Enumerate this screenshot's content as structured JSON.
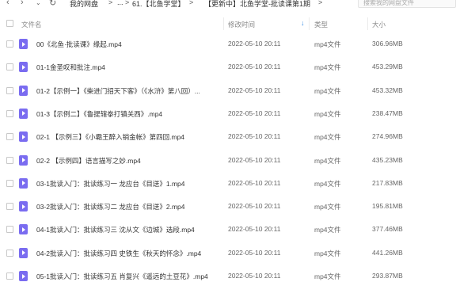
{
  "nav": {
    "back_icon": "chevron-left-icon",
    "forward_icon": "chevron-right-icon",
    "dropdown_icon": "chevron-down-icon",
    "refresh_icon": "refresh-icon",
    "breadcrumbs": [
      "我的网盘",
      "...",
      "61.【北鱼学堂】",
      "【更新中】北鱼学堂-批读课第1期",
      ""
    ],
    "search_placeholder": "搜索我的网盘文件"
  },
  "header": {
    "name": "文件名",
    "date": "修改时间",
    "type": "类型",
    "size": "大小",
    "sort_icon": "arrow-down-icon",
    "accent": "#3a8ee6"
  },
  "icon_color": "#7a6cf0",
  "files": [
    {
      "name": "00《北鱼·批读课》缘起.mp4",
      "date": "2022-05-10 20:11",
      "type": "mp4文件",
      "size": "306.96MB"
    },
    {
      "name": "01-1金圣叹和批注.mp4",
      "date": "2022-05-10 20:11",
      "type": "mp4文件",
      "size": "453.29MB"
    },
    {
      "name": "01-2【示例一】《柴进门招天下客》（《水浒》第八回）...",
      "date": "2022-05-10 20:11",
      "type": "mp4文件",
      "size": "453.32MB"
    },
    {
      "name": "01-3【示例二】《鲁提辖拳打镇关西》.mp4",
      "date": "2022-05-10 20:11",
      "type": "mp4文件",
      "size": "238.47MB"
    },
    {
      "name": "02-1 【示例三】《小霸王醉入销金帐》第四回.mp4",
      "date": "2022-05-10 20:11",
      "type": "mp4文件",
      "size": "274.96MB"
    },
    {
      "name": "02-2 【示例四】语言描写之妙.mp4",
      "date": "2022-05-10 20:11",
      "type": "mp4文件",
      "size": "435.23MB"
    },
    {
      "name": "03-1批读入门：批读练习一 龙应台《目送》1.mp4",
      "date": "2022-05-10 20:11",
      "type": "mp4文件",
      "size": "217.83MB"
    },
    {
      "name": "03-2批读入门：批读练习二 龙应台《目送》2.mp4",
      "date": "2022-05-10 20:11",
      "type": "mp4文件",
      "size": "195.81MB"
    },
    {
      "name": "04-1批读入门：批读练习三 沈从文《边城》选段.mp4",
      "date": "2022-05-10 20:11",
      "type": "mp4文件",
      "size": "377.46MB"
    },
    {
      "name": "04-2批读入门：批读练习四 史铁生《秋天的怀念》.mp4",
      "date": "2022-05-10 20:11",
      "type": "mp4文件",
      "size": "441.26MB"
    },
    {
      "name": "05-1批读入门：批读练习五 肖复兴《遥远的土豆花》.mp4",
      "date": "2022-05-10 20:11",
      "type": "mp4文件",
      "size": "293.87MB"
    }
  ]
}
